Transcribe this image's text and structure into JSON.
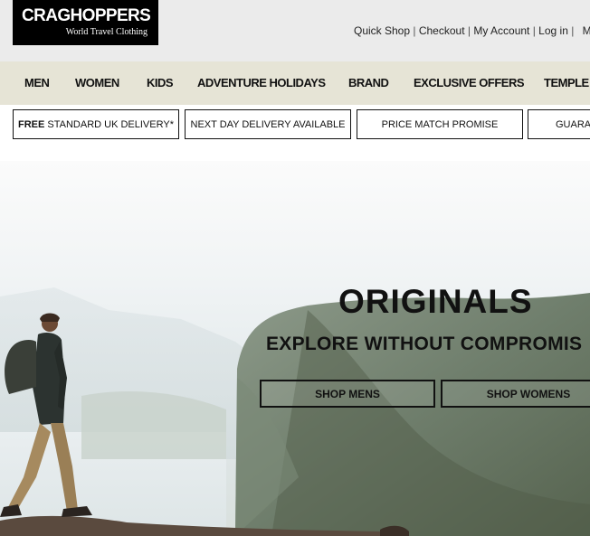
{
  "brand": {
    "name": "CRAGHOPPERS",
    "tagline": "World Travel Clothing"
  },
  "top_links": [
    "Quick Shop",
    "Checkout",
    "My Account",
    "Log in",
    "M"
  ],
  "nav": [
    "MEN",
    "WOMEN",
    "KIDS",
    "ADVENTURE HOLIDAYS",
    "BRAND",
    "EXCLUSIVE OFFERS",
    "TEMPLE"
  ],
  "usp": {
    "delivery_bold": "FREE",
    "delivery_rest": " STANDARD UK DELIVERY*",
    "next_day": "NEXT DAY DELIVERY AVAILABLE",
    "price_match": "PRICE MATCH PROMISE",
    "guarantee": "GUARA"
  },
  "hero": {
    "title": "ORIGINALS",
    "subtitle": "EXPLORE WITHOUT COMPROMIS",
    "shop_mens": "SHOP MENS",
    "shop_womens": "SHOP WOMENS"
  }
}
